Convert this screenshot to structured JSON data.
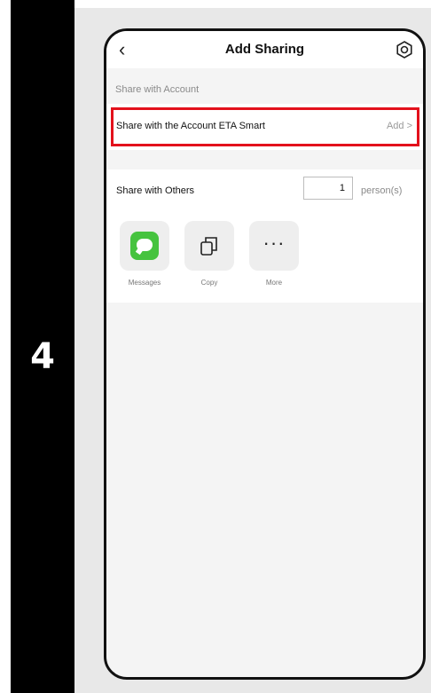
{
  "step": {
    "number": "4"
  },
  "nav": {
    "back_icon": "‹",
    "title": "Add Sharing",
    "settings_icon": "settings-icon"
  },
  "share_with_account": {
    "section_label": "Share with Account",
    "row_label": "Share with the Account ETA Smart",
    "action_label": "Add >",
    "highlight_color": "#e3111c"
  },
  "share_with_others": {
    "label": "Share with Others",
    "count_value": "1",
    "unit_label": "person(s)",
    "options": [
      {
        "label": "Messages",
        "icon": "messages-icon",
        "color": "#46c33f"
      },
      {
        "label": "Copy",
        "icon": "copy-icon"
      },
      {
        "label": "More",
        "icon": "more-icon"
      }
    ]
  }
}
